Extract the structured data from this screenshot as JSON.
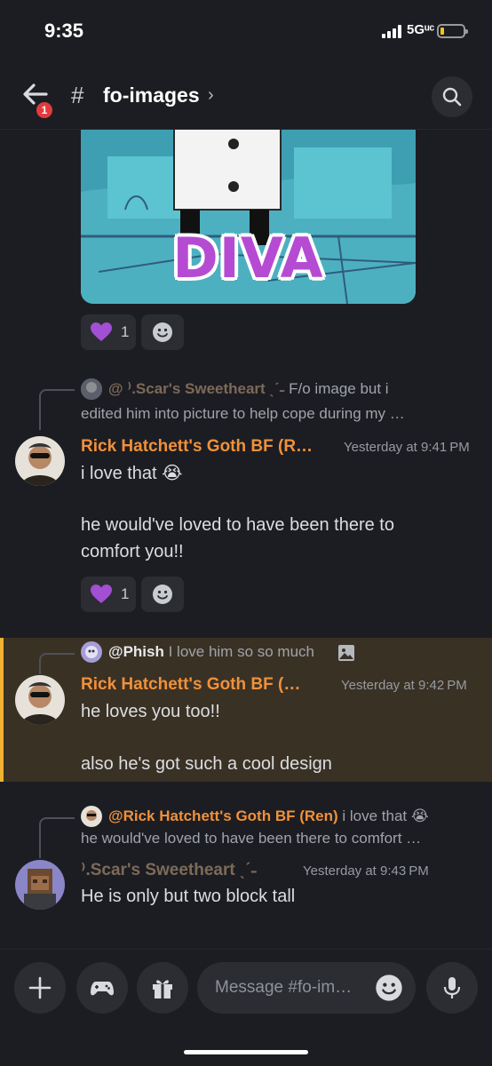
{
  "status": {
    "time": "9:35",
    "network": "5Gᵘᶜ"
  },
  "header": {
    "unread_badge": "1",
    "hash": "#",
    "channel_name": "fo-images",
    "chevron": "›"
  },
  "image_post": {
    "image_text": "DIVA",
    "reaction_count": "1"
  },
  "messages": [
    {
      "reply_author": "@ ⁾.Scar's Sweetheart ˎˊ˗",
      "reply_preview": " F/o image but i",
      "reply_preview_line2": "edited him into picture to help cope during my …",
      "author": "Rick Hatchett's Goth BF (R…",
      "timestamp": "Yesterday at 9:41 PM",
      "line1": "i love that 😭",
      "line2": "he would've loved to have been there to",
      "line3": "comfort you!!",
      "reaction_count": "1"
    },
    {
      "reply_author": "@Phish",
      "reply_preview": " I love him so so much",
      "author": "Rick Hatchett's Goth BF (…",
      "timestamp": "Yesterday at 9:42 PM",
      "line1": "he loves you too!!",
      "line2": "also he's got such a cool design"
    },
    {
      "reply_author": "@Rick Hatchett's Goth BF (Ren)",
      "reply_preview": " i love that 😭",
      "reply_preview_line2": "he would've loved to have been there to comfort …",
      "author": "⁾.Scar's Sweetheart ˎˊ˗",
      "timestamp": "Yesterday at 9:43 PM",
      "line1": "He is only but two block tall"
    }
  ],
  "composer": {
    "placeholder": "Message #fo-im…"
  },
  "colors": {
    "background": "#1c1d22",
    "author_orange": "#f0913a",
    "highlight": "#3a3125",
    "highlight_bar": "#f0b232",
    "badge_red": "#e23b3f"
  }
}
